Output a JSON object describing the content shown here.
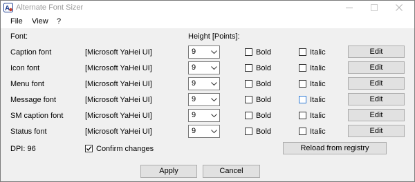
{
  "window": {
    "title": "Alternate Font Sizer",
    "minimize_icon": "minimize-icon",
    "maximize_icon": "maximize-icon",
    "close_icon": "close-icon"
  },
  "menu": [
    {
      "label": "File"
    },
    {
      "label": "View"
    },
    {
      "label": "?"
    }
  ],
  "headers": {
    "font": "Font:",
    "height": "Height [Points]:"
  },
  "rows": [
    {
      "name": "Caption font",
      "face": "[Microsoft YaHei UI]",
      "size": "9",
      "bold_label": "Bold",
      "bold_checked": false,
      "italic_label": "Italic",
      "italic_checked": false,
      "edit_label": "Edit"
    },
    {
      "name": "Icon font",
      "face": "[Microsoft YaHei UI]",
      "size": "9",
      "bold_label": "Bold",
      "bold_checked": false,
      "italic_label": "Italic",
      "italic_checked": false,
      "edit_label": "Edit"
    },
    {
      "name": "Menu font",
      "face": "[Microsoft YaHei UI]",
      "size": "9",
      "bold_label": "Bold",
      "bold_checked": false,
      "italic_label": "Italic",
      "italic_checked": false,
      "edit_label": "Edit"
    },
    {
      "name": "Message font",
      "face": "[Microsoft YaHei UI]",
      "size": "9",
      "bold_label": "Bold",
      "bold_checked": false,
      "italic_label": "Italic",
      "italic_checked": false,
      "edit_label": "Edit"
    },
    {
      "name": "SM caption font",
      "face": "[Microsoft YaHei UI]",
      "size": "9",
      "bold_label": "Bold",
      "bold_checked": false,
      "italic_label": "Italic",
      "italic_checked": false,
      "edit_label": "Edit"
    },
    {
      "name": "Status font",
      "face": "[Microsoft YaHei UI]",
      "size": "9",
      "bold_label": "Bold",
      "bold_checked": false,
      "italic_label": "Italic",
      "italic_checked": false,
      "edit_label": "Edit"
    }
  ],
  "dpi": "DPI: 96",
  "confirm": {
    "label": "Confirm changes",
    "checked": true
  },
  "reload_label": "Reload from registry",
  "apply_label": "Apply",
  "cancel_label": "Cancel",
  "colors": {
    "client_bg": "#f0f0f0",
    "button_bg": "#e1e1e1",
    "title_text": "#999999",
    "focus_border": "#2b79d6"
  }
}
